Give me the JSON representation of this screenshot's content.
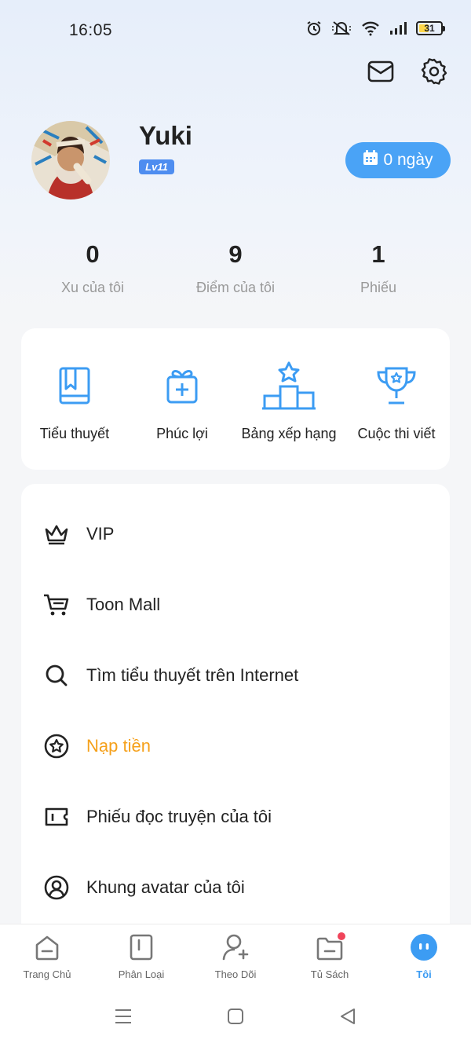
{
  "status_bar": {
    "time": "16:05",
    "battery_level": "31",
    "icons": [
      "alarm-icon",
      "mute-icon",
      "wifi-icon",
      "signal-icon",
      "battery-icon"
    ]
  },
  "header": {
    "actions": [
      "mail-icon",
      "settings-icon"
    ]
  },
  "profile": {
    "username": "Yuki",
    "level": "Lv11",
    "checkin_label": "0 ngày"
  },
  "stats": [
    {
      "value": "0",
      "label": "Xu của tôi"
    },
    {
      "value": "9",
      "label": "Điểm của tôi"
    },
    {
      "value": "1",
      "label": "Phiếu"
    }
  ],
  "quick_links": [
    {
      "label": "Tiểu thuyết",
      "icon": "book-icon"
    },
    {
      "label": "Phúc lợi",
      "icon": "gift-icon"
    },
    {
      "label": "Bảng xếp hạng",
      "icon": "podium-icon"
    },
    {
      "label": "Cuộc thi viết",
      "icon": "trophy-icon"
    }
  ],
  "menu": [
    {
      "label": "VIP",
      "icon": "crown-icon"
    },
    {
      "label": "Toon Mall",
      "icon": "cart-icon"
    },
    {
      "label": "Tìm tiểu thuyết trên Internet",
      "icon": "search-icon"
    },
    {
      "label": "Nạp tiền",
      "icon": "star-circle-icon",
      "highlight": true
    },
    {
      "label": "Phiếu đọc truyện của tôi",
      "icon": "ticket-icon"
    },
    {
      "label": "Khung avatar của tôi",
      "icon": "avatar-frame-icon"
    }
  ],
  "tabs": [
    {
      "label": "Trang Chủ",
      "icon": "home-icon"
    },
    {
      "label": "Phân Loại",
      "icon": "category-icon"
    },
    {
      "label": "Theo Dõi",
      "icon": "follow-icon"
    },
    {
      "label": "Tủ Sách",
      "icon": "bookshelf-icon",
      "badge": true
    },
    {
      "label": "Tôi",
      "icon": "me-icon",
      "active": true
    }
  ],
  "colors": {
    "accent": "#3c9cf3",
    "highlight": "#f5a01a",
    "badge": "#f0445a"
  }
}
